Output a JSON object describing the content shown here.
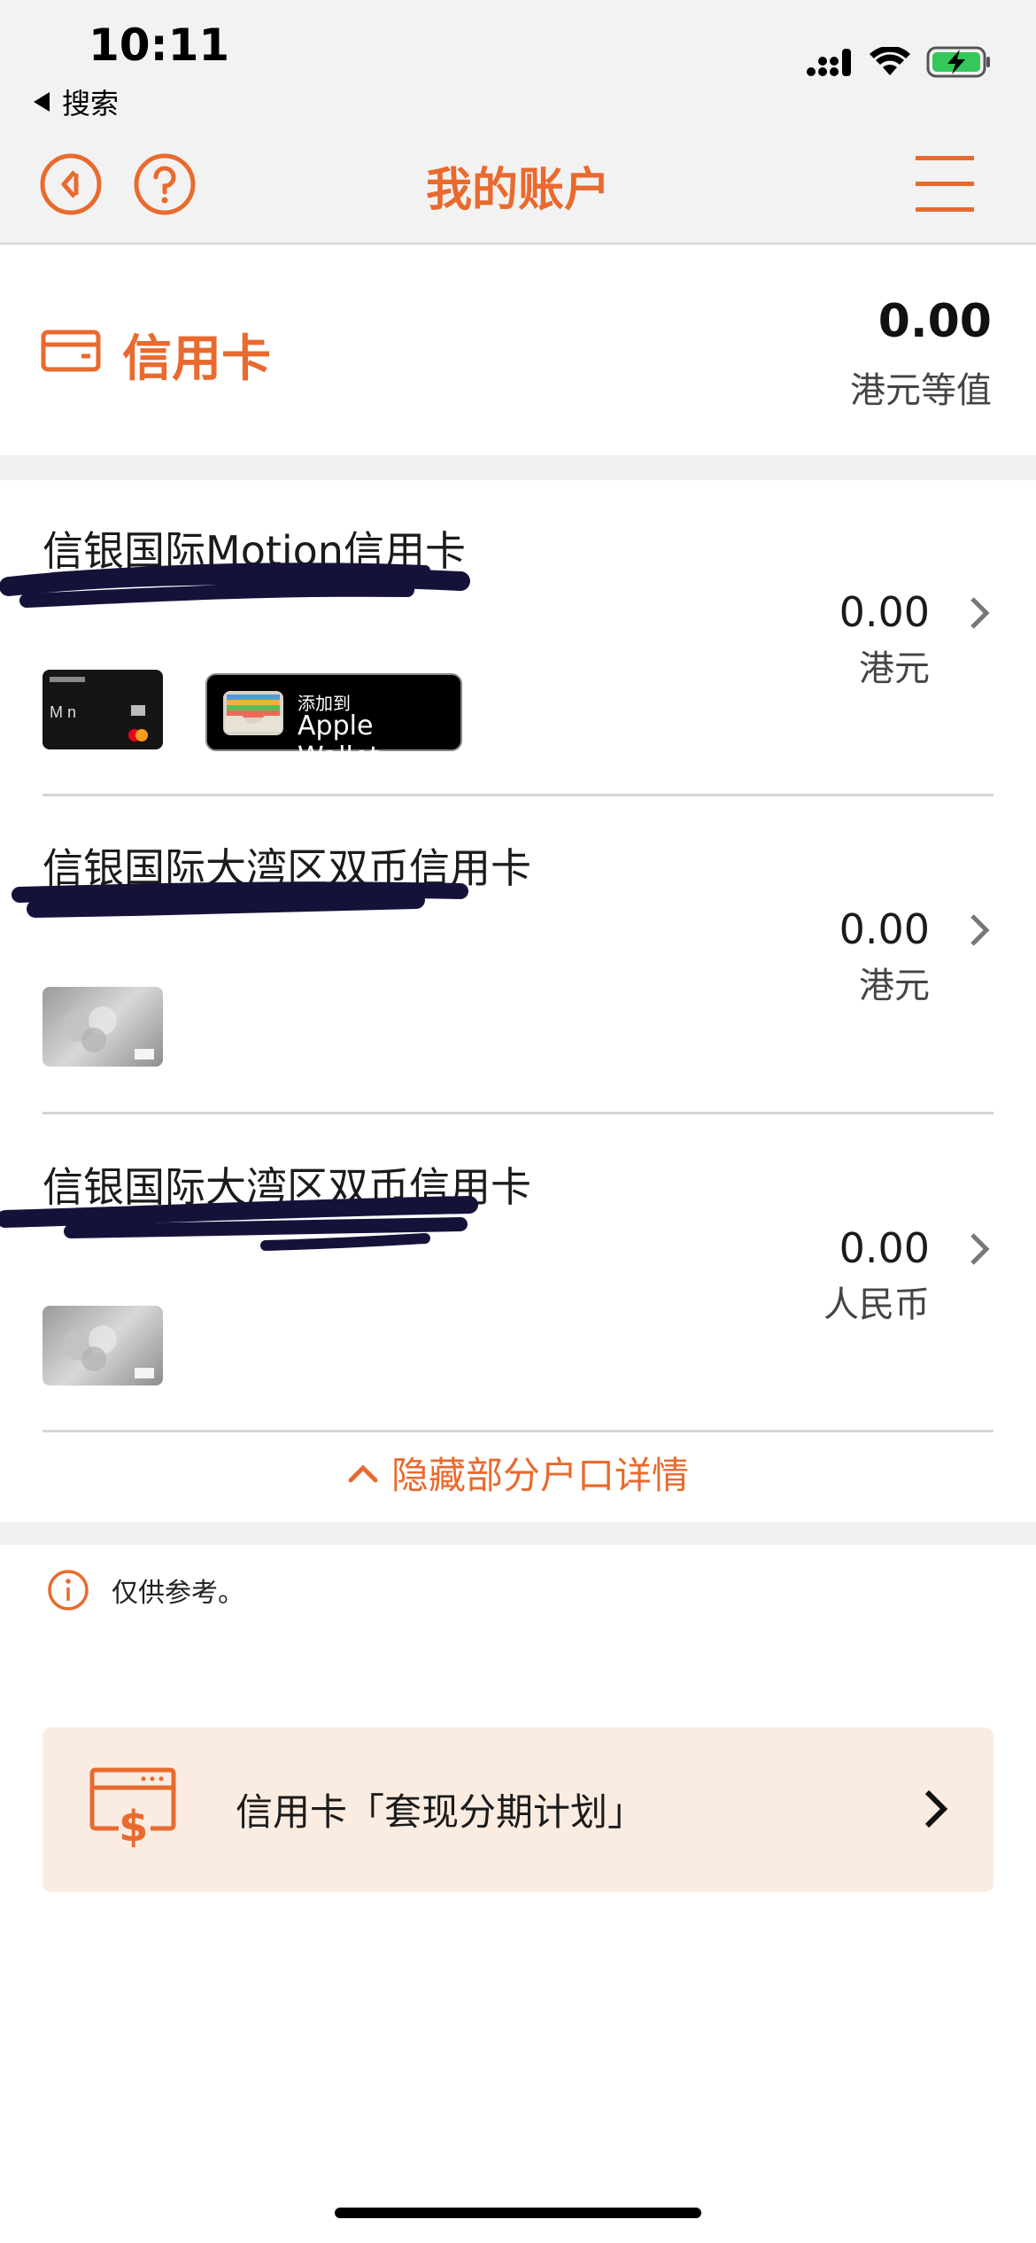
{
  "status_bar": {
    "time": "10:11",
    "back_label": "搜索",
    "icons": [
      "signal-icon",
      "wifi-icon",
      "battery-charging-icon"
    ]
  },
  "nav": {
    "title": "我的账户",
    "back_icon": "back-circle-icon",
    "help_icon": "help-circle-icon",
    "menu_icon": "hamburger-menu-icon"
  },
  "summary": {
    "label": "信用卡",
    "amount": "0.00",
    "unit": "港元等值",
    "icon": "credit-card-icon"
  },
  "cards": [
    {
      "name": "信银国际Motion信用卡",
      "amount": "0.00",
      "currency": "港元",
      "has_wallet": true
    },
    {
      "name": "信银国际大湾区双币信用卡",
      "amount": "0.00",
      "currency": "港元",
      "has_wallet": false
    },
    {
      "name": "信银国际大湾区双币信用卡",
      "amount": "0.00",
      "currency": "人民币",
      "has_wallet": false
    }
  ],
  "wallet_button": {
    "small_text": "添加到",
    "big_text": "Apple Wallet"
  },
  "hide_link": "隐藏部分户口详情",
  "disclaimer": "仅供参考。",
  "promo": {
    "text": "信用卡「套现分期计划」",
    "icon": "cash-card-icon"
  },
  "colors": {
    "accent": "#e96a2e",
    "nav_bg": "#f2f2f2",
    "promo_bg": "#fbece2"
  }
}
